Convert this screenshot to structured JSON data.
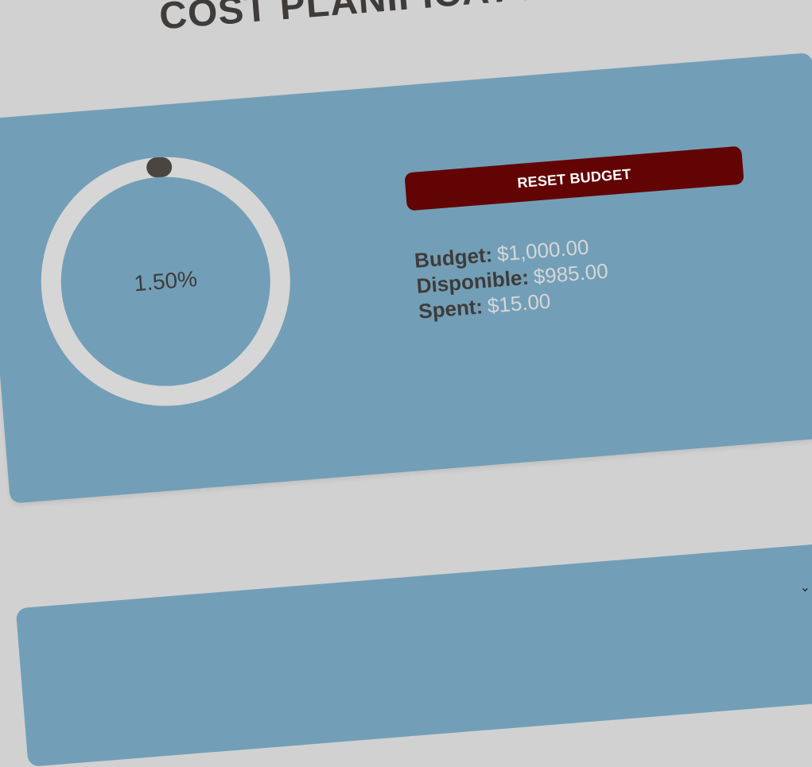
{
  "header": {
    "title": "COST PLANIFICATOR"
  },
  "budget_card": {
    "progress": {
      "label": "1.50%",
      "fraction": 0.015
    },
    "reset_button_label": "RESET BUDGET",
    "summary": [
      {
        "label": "Budget:",
        "value": "$1,000.00"
      },
      {
        "label": "Disponible:",
        "value": "$985.00"
      },
      {
        "label": "Spent:",
        "value": "$15.00"
      }
    ]
  },
  "colors": {
    "page_background": "#d1d1d1",
    "card_background": "#729fb7",
    "ring_track": "#d6d6d6",
    "ring_progress": "#4a4542",
    "reset_button": "#630404",
    "label_text": "#3f3b39",
    "value_text": "#d6d6d6"
  },
  "icons": {
    "scroll": "chevron-down-icon"
  }
}
